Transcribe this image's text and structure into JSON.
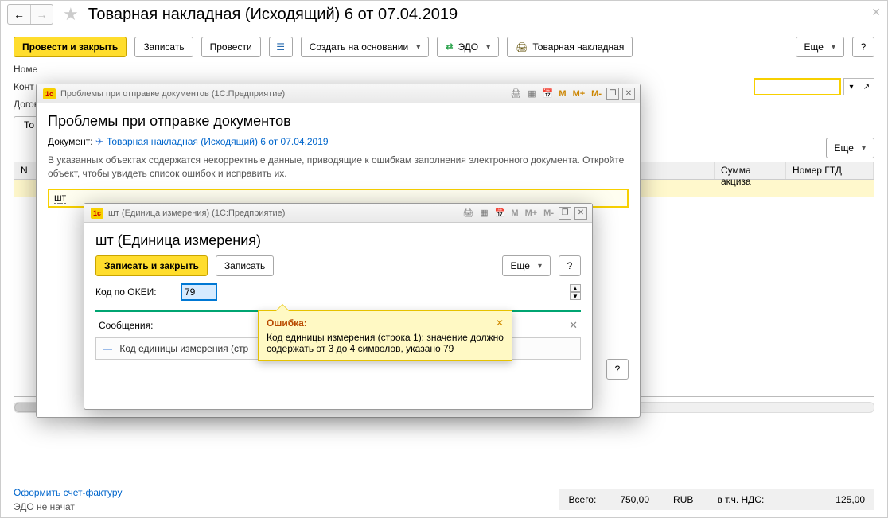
{
  "page": {
    "title": "Товарная накладная (Исходящий) 6 от 07.04.2019"
  },
  "toolbar": {
    "post_close": "Провести и закрыть",
    "write": "Записать",
    "post": "Провести",
    "create_based": "Создать на основании",
    "edo": "ЭДО",
    "print_torg": "Товарная накладная",
    "more": "Еще",
    "help": "?"
  },
  "fields": {
    "number_label": "Номе",
    "kontr_label": "Конт",
    "dogov_label": "Догов"
  },
  "tab": {
    "goods": "То"
  },
  "table": {
    "headers": {
      "n": "N",
      "sum_akciz": "Сумма акциза",
      "gtd": "Номер ГТД"
    },
    "more": "Еще"
  },
  "footer": {
    "link_sf": "Оформить счет-фактуру",
    "edo_status": "ЭДО не начат",
    "total_label": "Всего:",
    "total_value": "750,00",
    "currency": "RUB",
    "vat_label": "в т.ч. НДС:",
    "vat_value": "125,00"
  },
  "modal1": {
    "hdr": "Проблемы при отправке документов  (1С:Предприятие)",
    "title": "Проблемы при отправке документов",
    "doc_label": "Документ:",
    "doc_link": "Товарная накладная (Исходящий) 6 от 07.04.2019",
    "info": "В указанных объектах содержатся некорректные данные, приводящие к ошибкам заполнения электронного документа. Откройте объект, чтобы увидеть список ошибок и исправить их.",
    "unit_link": "шт",
    "help": "?"
  },
  "modal2": {
    "hdr": "шт (Единица измерения)  (1С:Предприятие)",
    "title": "шт (Единица измерения)",
    "save_close": "Записать и закрыть",
    "write": "Записать",
    "more": "Еще",
    "help": "?",
    "okei_label": "Код по ОКЕИ:",
    "okei_value": "79",
    "messages_label": "Сообщения:",
    "message_text": "Код единицы измерения (стр"
  },
  "tooltip": {
    "title": "Ошибка:",
    "text": "Код единицы измерения (строка 1): значение должно содержать от 3 до 4 символов, указано 79"
  }
}
